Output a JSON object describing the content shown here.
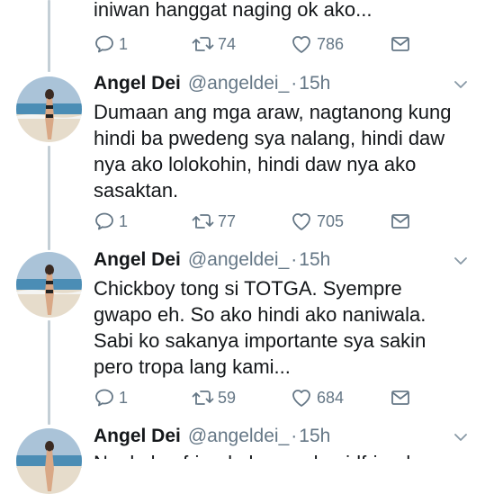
{
  "tweets": [
    {
      "text": "iniwan hanggat naging ok ako...",
      "reply_count": "1",
      "retweet_count": "74",
      "like_count": "786"
    },
    {
      "name": "Angel Dei",
      "handle": "@angeldei_",
      "separator": "·",
      "time": "15h",
      "text": "Dumaan ang mga araw, nagtanong kung\nhindi ba pwedeng sya nalang, hindi daw\nnya ako lolokohin, hindi daw nya ako\nsasaktan.",
      "reply_count": "1",
      "retweet_count": "77",
      "like_count": "705"
    },
    {
      "name": "Angel Dei",
      "handle": "@angeldei_",
      "separator": "·",
      "time": "15h",
      "text": "Chickboy tong si TOTGA. Syempre\ngwapo eh. So ako hindi ako naniwala.\nSabi ko sakanya importante sya sakin\npero tropa lang kami...",
      "reply_count": "1",
      "retweet_count": "59",
      "like_count": "684"
    },
    {
      "name": "Angel Dei",
      "handle": "@angeldei_",
      "separator": "·",
      "time": "15h",
      "text": "Nagkaboyfriend ako, nagkagirlfriend sya"
    }
  ],
  "icons": {
    "reply": "reply-icon",
    "retweet": "retweet-icon",
    "like": "heart-icon",
    "dm": "envelope-icon",
    "more": "chevron-down-icon",
    "avatar": "avatar-beach-photo"
  },
  "colors": {
    "text": "#14171a",
    "secondary": "#657786",
    "thread_line": "#c4cfd6"
  }
}
